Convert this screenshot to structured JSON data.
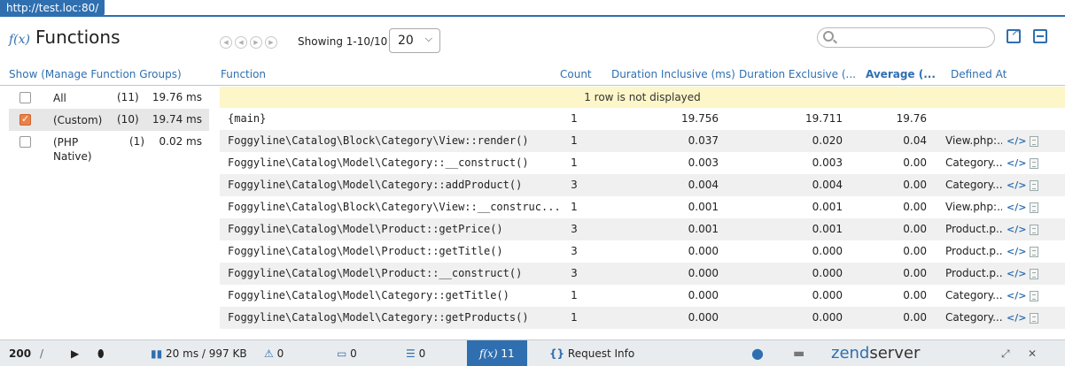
{
  "url_tab": "http://test.loc:80/",
  "header": {
    "fx_label": "f(x)",
    "title": "Functions",
    "showing": "Showing 1-10/10",
    "per_page": "20"
  },
  "columns": {
    "show": "Show (Manage Function Groups)",
    "function": "Function",
    "count": "Count",
    "duration_inclusive": "Duration Inclusive (ms)",
    "duration_exclusive": "Duration Exclusive (...",
    "average": "Average (...",
    "defined_at": "Defined At"
  },
  "groups": [
    {
      "name": "All",
      "count": "(11)",
      "time": "19.76 ms",
      "checked": false
    },
    {
      "name": "(Custom)",
      "count": "(10)",
      "time": "19.74 ms",
      "checked": true
    },
    {
      "name": "(PHP\nNative)",
      "count": "(1)",
      "time": "0.02 ms",
      "checked": false
    }
  ],
  "notice": "1 row is not displayed",
  "rows": [
    {
      "fn": "{main}",
      "count": "1",
      "incl": "19.756",
      "excl": "19.711",
      "avg": "19.76",
      "def": ""
    },
    {
      "fn": "Foggyline\\Catalog\\Block\\Category\\View::render()",
      "count": "1",
      "incl": "0.037",
      "excl": "0.020",
      "avg": "0.04",
      "def": "View.php:..."
    },
    {
      "fn": "Foggyline\\Catalog\\Model\\Category::__construct()",
      "count": "1",
      "incl": "0.003",
      "excl": "0.003",
      "avg": "0.00",
      "def": "Category...."
    },
    {
      "fn": "Foggyline\\Catalog\\Model\\Category::addProduct()",
      "count": "3",
      "incl": "0.004",
      "excl": "0.004",
      "avg": "0.00",
      "def": "Category...."
    },
    {
      "fn": "Foggyline\\Catalog\\Block\\Category\\View::__construc...",
      "count": "1",
      "incl": "0.001",
      "excl": "0.001",
      "avg": "0.00",
      "def": "View.php:..."
    },
    {
      "fn": "Foggyline\\Catalog\\Model\\Product::getPrice()",
      "count": "3",
      "incl": "0.001",
      "excl": "0.001",
      "avg": "0.00",
      "def": "Product.p..."
    },
    {
      "fn": "Foggyline\\Catalog\\Model\\Product::getTitle()",
      "count": "3",
      "incl": "0.000",
      "excl": "0.000",
      "avg": "0.00",
      "def": "Product.p..."
    },
    {
      "fn": "Foggyline\\Catalog\\Model\\Product::__construct()",
      "count": "3",
      "incl": "0.000",
      "excl": "0.000",
      "avg": "0.00",
      "def": "Product.p..."
    },
    {
      "fn": "Foggyline\\Catalog\\Model\\Category::getTitle()",
      "count": "1",
      "incl": "0.000",
      "excl": "0.000",
      "avg": "0.00",
      "def": "Category...."
    },
    {
      "fn": "Foggyline\\Catalog\\Model\\Category::getProducts()",
      "count": "1",
      "incl": "0.000",
      "excl": "0.000",
      "avg": "0.00",
      "def": "Category...."
    }
  ],
  "toolbar": {
    "status": "200",
    "slash": "/",
    "perf": "20 ms / 997 KB",
    "warnings": "0",
    "logs": "0",
    "db": "0",
    "functions_label": "f(x)",
    "functions_count": "11",
    "request_info": "Request Info",
    "brand_a": "zend",
    "brand_b": "server"
  },
  "colors": {
    "accent": "#2f6fb0",
    "notice_bg": "#fdf6c9",
    "checkbox_on": "#e8824a"
  }
}
